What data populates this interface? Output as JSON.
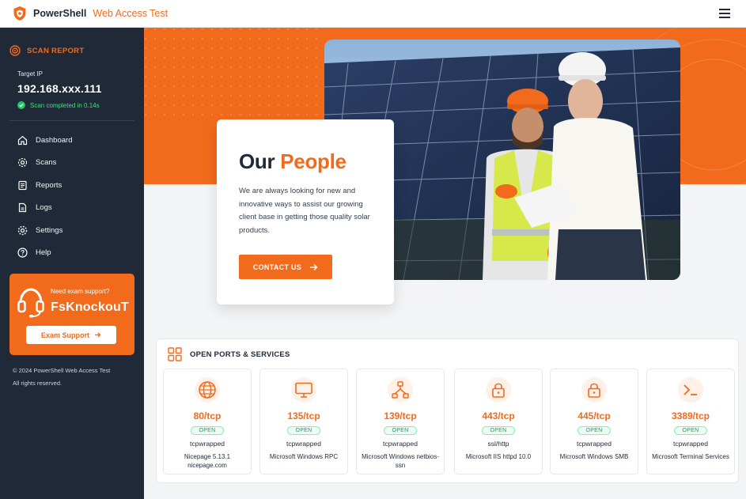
{
  "header": {
    "title": "PowerShell",
    "subtitle": "Web Access Test"
  },
  "sidebar": {
    "scan_title": "SCAN REPORT",
    "target_label": "Target IP",
    "target_ip": "192.168.xxx.111",
    "status": "Scan completed in 0.14s",
    "nav": [
      {
        "label": "Dashboard",
        "icon": "home-icon"
      },
      {
        "label": "Scans",
        "icon": "gear-icon"
      },
      {
        "label": "Reports",
        "icon": "document-icon"
      },
      {
        "label": "Logs",
        "icon": "file-icon"
      },
      {
        "label": "Settings",
        "icon": "settings-icon"
      },
      {
        "label": "Help",
        "icon": "help-icon"
      }
    ],
    "support": {
      "question": "Need exam support?",
      "name": "FsKnockouT",
      "button": "Exam Support"
    },
    "copyright_line1": "© 2024 PowerShell Web Access Test",
    "copyright_line2": "All rights reserved."
  },
  "hero": {
    "title_plain": "Our",
    "title_accent": "People",
    "description": "We are always looking for new and innovative ways to assist our growing client base in getting those quality solar products.",
    "button": "CONTACT US"
  },
  "ports": {
    "title": "OPEN PORTS & SERVICES",
    "items": [
      {
        "port": "80/tcp",
        "status": "OPEN",
        "protocol": "tcpwrapped",
        "service": "Nicepage 5.13.1 nicepage.com",
        "icon": "globe-icon"
      },
      {
        "port": "135/tcp",
        "status": "OPEN",
        "protocol": "tcpwrapped",
        "service": "Microsoft Windows RPC",
        "icon": "monitor-icon"
      },
      {
        "port": "139/tcp",
        "status": "OPEN",
        "protocol": "tcpwrapped",
        "service": "Microsoft Windows netbios-ssn",
        "icon": "network-icon"
      },
      {
        "port": "443/tcp",
        "status": "OPEN",
        "protocol": "ssl/http",
        "service": "Microsoft IIS httpd 10.0",
        "icon": "lock-icon"
      },
      {
        "port": "445/tcp",
        "status": "OPEN",
        "protocol": "tcpwrapped",
        "service": "Microsoft Windows SMB",
        "icon": "lock-icon"
      },
      {
        "port": "3389/tcp",
        "status": "OPEN",
        "protocol": "tcpwrapped",
        "service": "Microsoft Terminal Services",
        "icon": "terminal-icon"
      }
    ]
  },
  "colors": {
    "accent": "#f26b1d",
    "sidebar_bg": "#1f2937",
    "open_green": "#16a34a"
  }
}
